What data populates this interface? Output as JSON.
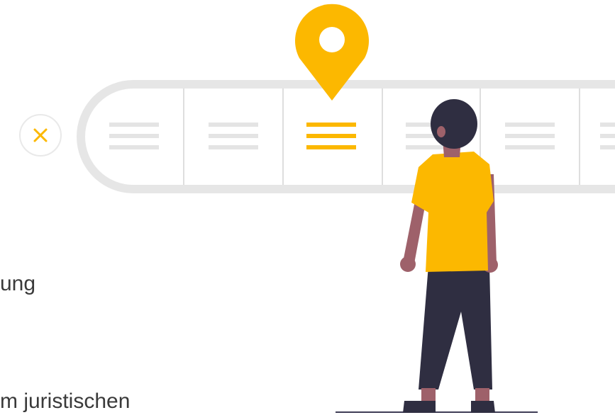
{
  "text_fragments": [
    "ung",
    "m juristischen"
  ],
  "icons": {
    "close": "close-icon",
    "pin": "map-pin-icon",
    "menu": "hamburger-menu-icon"
  },
  "colors": {
    "accent": "#FCB800",
    "bar_track": "#E6E6E6",
    "menu_lines": "#E4E4E4",
    "divider": "#DADADA",
    "person_skin": "#9E616A",
    "person_dark": "#2F2E41",
    "text": "#3A3A3A"
  }
}
